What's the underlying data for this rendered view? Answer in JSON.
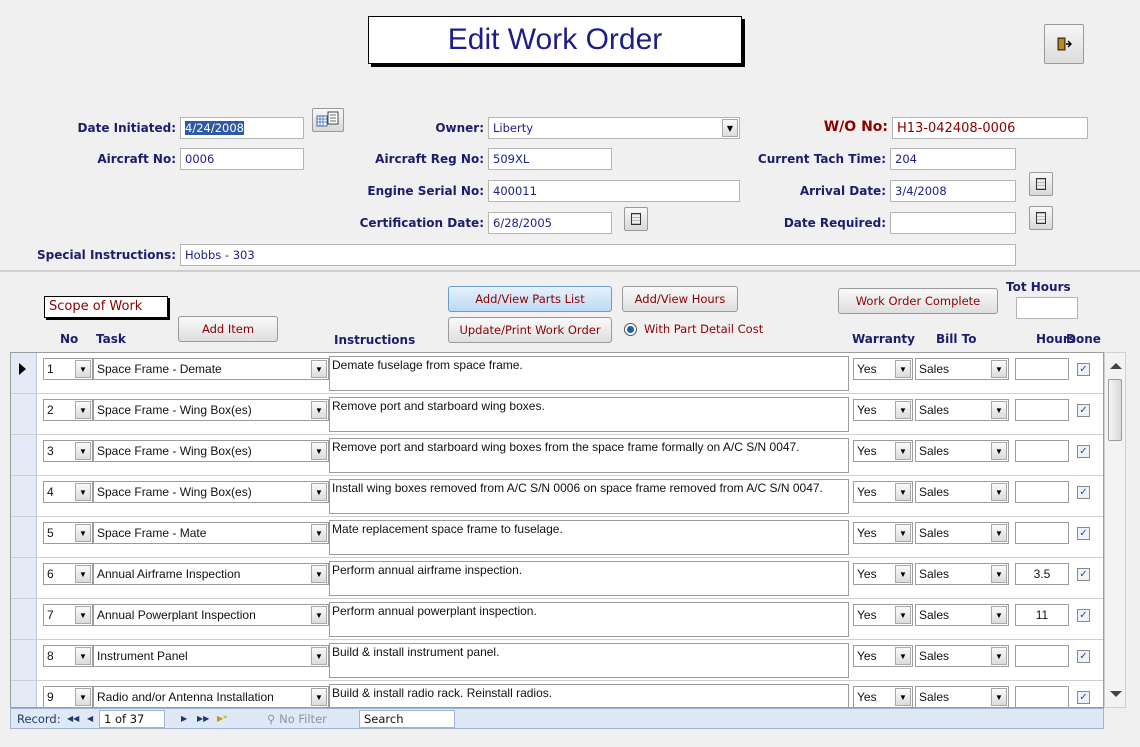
{
  "form": {
    "title": "Edit Work Order",
    "date_initiated_label": "Date Initiated:",
    "date_initiated": "4/24/2008",
    "owner_label": "Owner:",
    "owner": "Liberty",
    "wo_label": "W/O No:",
    "wo_no": "H13-042408-0006",
    "aircraft_no_label": "Aircraft No:",
    "aircraft_no": "0006",
    "aircraft_reg_label": "Aircraft Reg No:",
    "aircraft_reg": "509XL",
    "tach_label": "Current Tach Time:",
    "tach": "204",
    "engine_serial_label": "Engine Serial No:",
    "engine_serial": "400011",
    "arrival_label": "Arrival Date:",
    "arrival_date": "3/4/2008",
    "cert_label": "Certification Date:",
    "cert_date": "6/28/2005",
    "date_required_label": "Date Required:",
    "date_required": "",
    "special_label": "Special Instructions:",
    "special": "Hobbs - 303"
  },
  "scope": {
    "title": "Scope of Work",
    "add_item": "Add Item",
    "add_parts": "Add/View Parts List",
    "add_hours": "Add/View Hours",
    "update_print": "Update/Print Work Order",
    "with_part_detail": "With Part Detail Cost",
    "complete": "Work Order Complete",
    "tot_hours_label": "Tot Hours",
    "tot_hours": ""
  },
  "columns": {
    "no": "No",
    "task": "Task",
    "instructions": "Instructions",
    "warranty": "Warranty",
    "bill_to": "Bill To",
    "hours": "Hours",
    "done": "Done"
  },
  "rows": [
    {
      "no": "1",
      "task": "Space Frame - Demate",
      "instr": "Demate fuselage from space frame.",
      "warranty": "Yes",
      "bill": "Sales",
      "hours": "",
      "done": "✓"
    },
    {
      "no": "2",
      "task": "Space Frame - Wing Box(es)",
      "instr": "Remove port and starboard wing boxes.",
      "warranty": "Yes",
      "bill": "Sales",
      "hours": "",
      "done": "✓"
    },
    {
      "no": "3",
      "task": "Space Frame - Wing Box(es)",
      "instr": "Remove port and starboard wing boxes from the space frame formally on A/C S/N 0047.",
      "warranty": "Yes",
      "bill": "Sales",
      "hours": "",
      "done": "✓"
    },
    {
      "no": "4",
      "task": "Space Frame - Wing Box(es)",
      "instr": "Install wing boxes removed from A/C S/N 0006 on space frame removed from A/C S/N 0047.",
      "warranty": "Yes",
      "bill": "Sales",
      "hours": "",
      "done": "✓"
    },
    {
      "no": "5",
      "task": "Space Frame - Mate",
      "instr": "Mate replacement space frame to fuselage.",
      "warranty": "Yes",
      "bill": "Sales",
      "hours": "",
      "done": "✓"
    },
    {
      "no": "6",
      "task": "Annual Airframe Inspection",
      "instr": "Perform annual airframe inspection.",
      "warranty": "Yes",
      "bill": "Sales",
      "hours": "3.5",
      "done": "✓"
    },
    {
      "no": "7",
      "task": "Annual Powerplant Inspection",
      "instr": "Perform annual powerplant inspection.",
      "warranty": "Yes",
      "bill": "Sales",
      "hours": "11",
      "done": "✓"
    },
    {
      "no": "8",
      "task": "Instrument Panel",
      "instr": "Build & install instrument panel.",
      "warranty": "Yes",
      "bill": "Sales",
      "hours": "",
      "done": "✓"
    },
    {
      "no": "9",
      "task": "Radio and/or Antenna Installation",
      "instr": "Build & install radio rack.  Reinstall radios.",
      "warranty": "Yes",
      "bill": "Sales",
      "hours": "",
      "done": "✓"
    }
  ],
  "navbar": {
    "record_label": "Record:",
    "position": "1 of 37",
    "first": "◀◀",
    "prev": "◀",
    "next": "▶",
    "last": "▶▶",
    "new": "▶*",
    "filter": "No Filter",
    "search": "Search"
  },
  "icons": [
    "exit-icon",
    "calendar-icon",
    "dropdown-arrow-icon",
    "record-pointer-icon",
    "checkbox-icon",
    "filter-icon"
  ]
}
